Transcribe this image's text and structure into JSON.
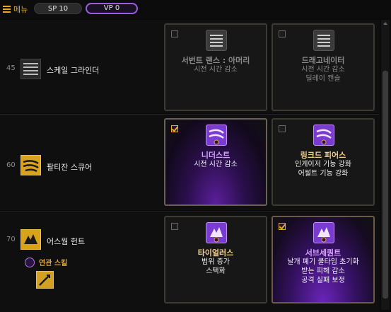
{
  "topbar": {
    "menu_label": "메뉴",
    "sp_label": "SP 10",
    "vp_label": "VP 0"
  },
  "rows": [
    {
      "level": "45",
      "skill_name": "스케일 그라인더",
      "icon": "striped-grey-icon",
      "cards": [
        {
          "checked": false,
          "title": "서번트 랜스 : 아머리",
          "desc1": "시전 시간 감소",
          "desc2": "",
          "desc3": ""
        },
        {
          "checked": false,
          "title": "드래고네이터",
          "desc1": "시전 시간 감소",
          "desc2": "딜레이 캔슬",
          "desc3": ""
        }
      ]
    },
    {
      "level": "60",
      "skill_name": "팔티잔 스큐어",
      "icon": "gold-slash-icon",
      "cards": [
        {
          "checked": true,
          "title": "니더스트",
          "desc1": "시전 시간 감소",
          "desc2": "",
          "desc3": ""
        },
        {
          "checked": false,
          "title": "링크드 피어스",
          "desc1": "인게이저 기능 강화",
          "desc2": "어썰트 기능 강화",
          "desc3": ""
        }
      ]
    },
    {
      "level": "70",
      "skill_name": "어스웜 헌트",
      "icon": "gold-dragon-icon",
      "related_label": "연관 스킬",
      "cards": [
        {
          "checked": false,
          "title": "타이얼러스",
          "desc1": "범위 증가",
          "desc2": "스택화",
          "desc3": ""
        },
        {
          "checked": true,
          "title": "서브세퀀트",
          "desc1": "날개 폐기 쿨타임 초기화",
          "desc2": "받는 피해 감소",
          "desc3": "공격 실패 보정"
        }
      ]
    }
  ],
  "colors": {
    "accent_gold": "#e2a92a",
    "accent_purple": "#9b5de5",
    "title_purple": "#d6a0ff"
  }
}
